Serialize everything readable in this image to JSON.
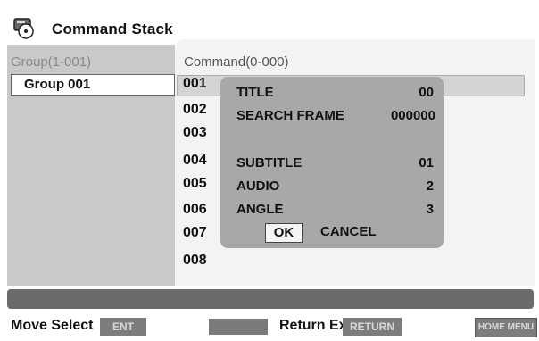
{
  "app": {
    "title": "Command Stack"
  },
  "groups": {
    "header": "Group(1-001)",
    "items": [
      {
        "label": "Group 001"
      }
    ]
  },
  "commands": {
    "header": "Command(0-000)",
    "numbers": [
      "001",
      "002",
      "003",
      "004",
      "005",
      "006",
      "007",
      "008"
    ]
  },
  "dialog": {
    "fields": [
      {
        "label": "TITLE",
        "value": "00"
      },
      {
        "label": "SEARCH FRAME",
        "value": "000000"
      },
      {
        "label": "SUBTITLE",
        "value": "01"
      },
      {
        "label": "AUDIO",
        "value": "2"
      },
      {
        "label": "ANGLE",
        "value": "3"
      }
    ],
    "ok_label": "OK",
    "cancel_label": "CANCEL"
  },
  "footer": {
    "move_select_label": "Move Select",
    "enter_badge": "ENT",
    "return_exit_label": "Return Exit",
    "return_badge": "RETURN",
    "home_menu_badge": "HOME MENU"
  }
}
